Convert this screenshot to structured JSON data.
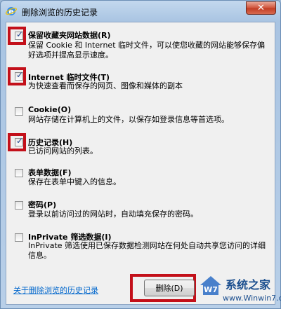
{
  "window": {
    "title": "删除浏览的历史记录",
    "close_label": "✕"
  },
  "options": [
    {
      "checked": true,
      "title": "保留收藏夹网站数据(R)",
      "desc": "保留 Cookie 和 Internet 临时文件，可以使您收藏的网站能够保存偏好选项并提高显示速度。"
    },
    {
      "checked": true,
      "title": "Internet 临时文件(T)",
      "desc": "为快速查看而保存的网页、图像和媒体的副本"
    },
    {
      "checked": false,
      "title": "Cookie(O)",
      "desc": "网站存储在计算机上的文件，以保存如登录信息等首选项。"
    },
    {
      "checked": true,
      "title": "历史记录(H)",
      "desc": "已访问网站的列表。"
    },
    {
      "checked": false,
      "title": "表单数据(F)",
      "desc": "保存在表单中键入的信息。"
    },
    {
      "checked": false,
      "title": "密码(P)",
      "desc": "登录以前访问过的网站时，自动填充保存的密码。"
    },
    {
      "checked": false,
      "title": "InPrivate 筛选数据(I)",
      "desc": "InPrivate 筛选使用已保存数据检测网站在何处自动共享您访问的详细信息。"
    }
  ],
  "footer": {
    "link_label": "关于删除浏览的历史记录",
    "delete_label": "删除(D)"
  },
  "watermark": {
    "name": "系统之家",
    "url": "www.Winwin7.com"
  },
  "colors": {
    "highlight": "#c3101a",
    "link": "#0066cc"
  }
}
